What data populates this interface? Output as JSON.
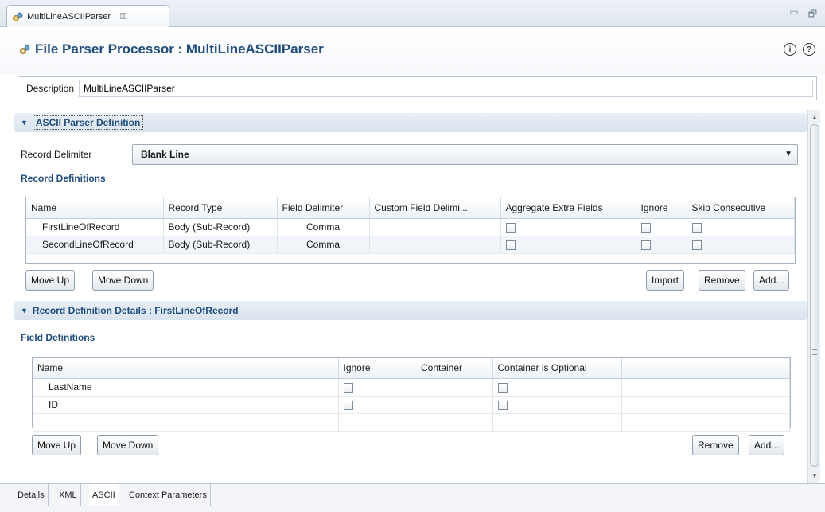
{
  "editor_tab": {
    "title": "MultiLineASCIIParser",
    "close": "☒"
  },
  "window_controls": {
    "minimize": "▭",
    "maximize": "🗗"
  },
  "header": {
    "title": "File Parser Processor : MultiLineASCIIParser",
    "info_icon": "i",
    "help_icon": "?"
  },
  "description": {
    "label": "Description",
    "value": "MultiLineASCIIParser"
  },
  "ascii_section": {
    "title": "ASCII Parser Definition",
    "record_delimiter_label": "Record Delimiter",
    "record_delimiter_value": "Blank Line",
    "record_definitions_label": "Record Definitions",
    "columns": [
      "Name",
      "Record Type",
      "Field Delimiter",
      "Custom Field Delimi...",
      "Aggregate Extra Fields",
      "Ignore",
      "Skip Consecutive"
    ],
    "rows": [
      {
        "name": "FirstLineOfRecord",
        "record_type": "Body (Sub-Record)",
        "field_delimiter": "Comma",
        "custom_field_delimiter": "",
        "aggregate": false,
        "ignore": false,
        "skip": false
      },
      {
        "name": "SecondLineOfRecord",
        "record_type": "Body (Sub-Record)",
        "field_delimiter": "Comma",
        "custom_field_delimiter": "",
        "aggregate": false,
        "ignore": false,
        "skip": false
      }
    ],
    "buttons": {
      "move_up": "Move Up",
      "move_down": "Move Down",
      "import": "Import",
      "remove": "Remove",
      "add": "Add..."
    }
  },
  "details_section": {
    "title": "Record Definition Details : FirstLineOfRecord",
    "field_definitions_label": "Field Definitions",
    "columns": [
      "Name",
      "Ignore",
      "Container",
      "Container is Optional",
      ""
    ],
    "rows": [
      {
        "name": "LastName",
        "ignore": false,
        "container": "",
        "container_optional": false
      },
      {
        "name": "ID",
        "ignore": false,
        "container": "",
        "container_optional": false
      }
    ],
    "buttons": {
      "move_up": "Move Up",
      "move_down": "Move Down",
      "remove": "Remove",
      "add": "Add..."
    }
  },
  "bottom_tabs": [
    "Details",
    "XML",
    "ASCII",
    "Context Parameters"
  ],
  "active_bottom_tab": "ASCII"
}
